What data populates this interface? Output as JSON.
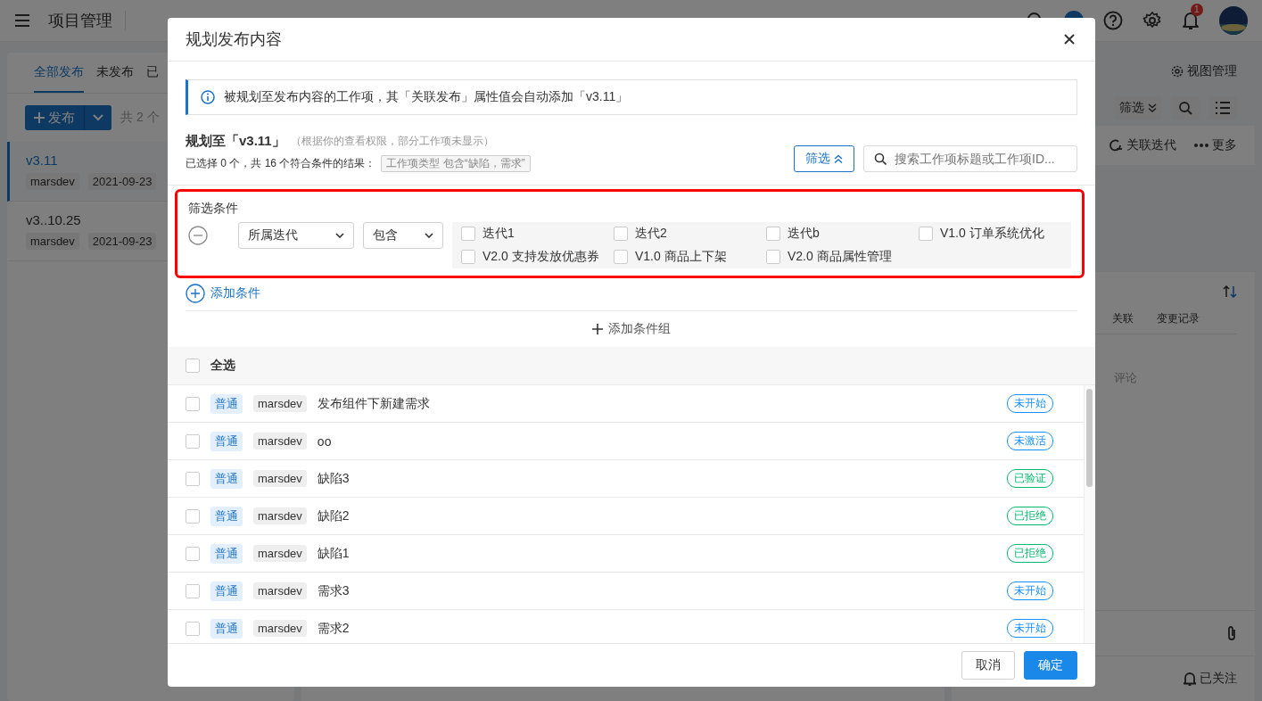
{
  "header": {
    "title": "项目管理",
    "notification_count": "1"
  },
  "left_panel": {
    "tabs": [
      {
        "label": "全部发布",
        "selected": true
      },
      {
        "label": "未发布",
        "selected": false
      },
      {
        "label": "已",
        "selected": false
      }
    ],
    "new_button": "发布",
    "count": "共 2 个",
    "releases": [
      {
        "name": "v3.11",
        "selected": true,
        "tags": [
          "marsdev",
          "2021-09-23"
        ]
      },
      {
        "name": "v3..10.25",
        "selected": false,
        "tags": [
          "marsdev",
          "2021-09-23"
        ]
      }
    ]
  },
  "right_panel": {
    "view_manage": "视图管理",
    "filter_button": "筛选",
    "actions": [
      {
        "kind": "iteration",
        "label": "关联迭代"
      },
      {
        "kind": "more",
        "label": "更多"
      }
    ],
    "detail_tabs": [
      "关联",
      "变更记录"
    ],
    "comment_text": "评论",
    "follow_button": "已关注"
  },
  "dialog": {
    "title": "规划发布内容",
    "info": "被规划至发布内容的工作项，其「关联发布」属性值会自动添加「v3.11」",
    "plan_title": "规划至「v3.11」",
    "plan_note": "（根据你的查看权限，部分工作项未显示）",
    "summary": "已选择 0 个，共 16 个符合条件的结果：",
    "condition_tag": "工作项类型 包含“缺陷，需求”",
    "filter_button": "筛选",
    "search_placeholder": "搜索工作项标题或工作项ID...",
    "filter_section": {
      "highlighted": true,
      "title": "筛选条件",
      "field": "所属迭代",
      "operator": "包含",
      "options": [
        {
          "label": "迭代1",
          "checked": false
        },
        {
          "label": "迭代2",
          "checked": false
        },
        {
          "label": "迭代b",
          "checked": false
        },
        {
          "label": "V1.0 订单系统优化",
          "checked": false
        },
        {
          "label": "V2.0 支持发放优惠券",
          "checked": false
        },
        {
          "label": "V1.0 商品上下架",
          "checked": false
        },
        {
          "label": "V2.0 商品属性管理",
          "checked": false
        }
      ]
    },
    "add_condition": "添加条件",
    "add_group": "添加条件组",
    "select_all": {
      "label": "全选",
      "checked": false
    },
    "items": [
      {
        "checked": false,
        "priority": "普通",
        "owner": "marsdev",
        "title": "发布组件下新建需求",
        "status": "未开始",
        "color": "#1890ff"
      },
      {
        "checked": false,
        "priority": "普通",
        "owner": "marsdev",
        "title": "oo",
        "status": "未激活",
        "color": "#1890ff"
      },
      {
        "checked": false,
        "priority": "普通",
        "owner": "marsdev",
        "title": "缺陷3",
        "status": "已验证",
        "color": "#00b96b"
      },
      {
        "checked": false,
        "priority": "普通",
        "owner": "marsdev",
        "title": "缺陷2",
        "status": "已拒绝",
        "color": "#00b96b"
      },
      {
        "checked": false,
        "priority": "普通",
        "owner": "marsdev",
        "title": "缺陷1",
        "status": "已拒绝",
        "color": "#00b96b"
      },
      {
        "checked": false,
        "priority": "普通",
        "owner": "marsdev",
        "title": "需求3",
        "status": "未开始",
        "color": "#1890ff"
      },
      {
        "checked": false,
        "priority": "普通",
        "owner": "marsdev",
        "title": "需求2",
        "status": "未开始",
        "color": "#1890ff"
      }
    ],
    "cancel_button": "取消",
    "ok_button": "确定"
  }
}
